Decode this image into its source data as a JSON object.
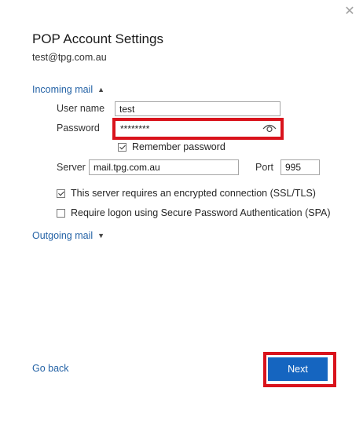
{
  "header": {
    "title": "POP Account Settings",
    "email": "test@tpg.com.au",
    "close_icon": "close-icon"
  },
  "incoming": {
    "toggle_label": "Incoming mail",
    "expanded": true,
    "user_name_label": "User name",
    "user_name_value": "test",
    "password_label": "Password",
    "password_value": "********",
    "remember_label": "Remember password",
    "remember_checked": true,
    "server_label": "Server",
    "server_value": "mail.tpg.com.au",
    "port_label": "Port",
    "port_value": "995",
    "ssl_label": "This server requires an encrypted connection (SSL/TLS)",
    "ssl_checked": true,
    "spa_label": "Require logon using Secure Password Authentication (SPA)",
    "spa_checked": false
  },
  "outgoing": {
    "toggle_label": "Outgoing mail",
    "expanded": false
  },
  "footer": {
    "go_back_label": "Go back",
    "next_label": "Next"
  },
  "colors": {
    "accent": "#1565c0",
    "link": "#2563a6",
    "highlight": "#d9131c"
  }
}
